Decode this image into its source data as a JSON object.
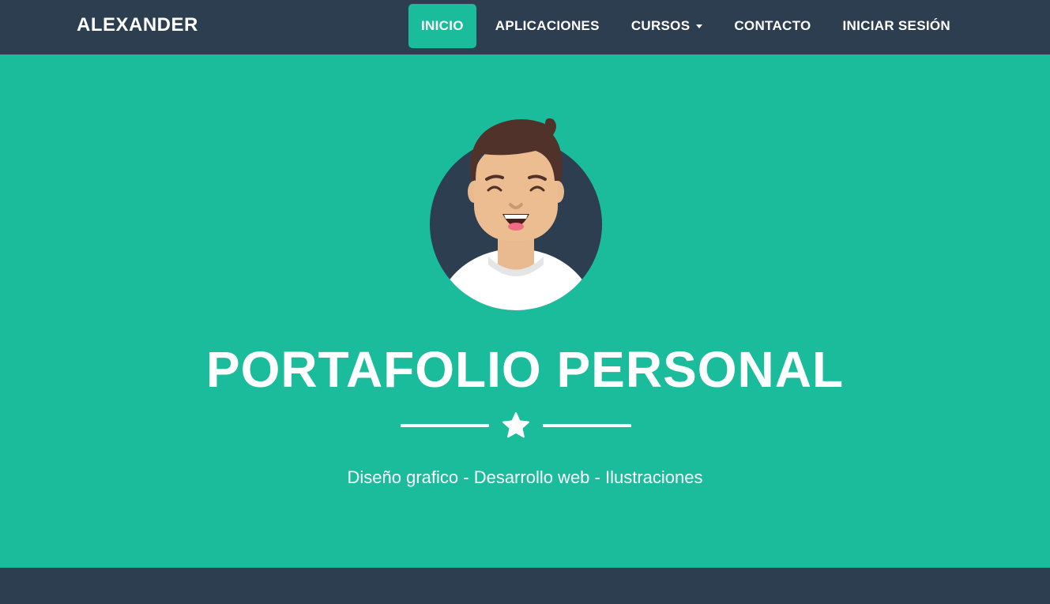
{
  "navbar": {
    "brand": "ALEXANDER",
    "links": [
      {
        "label": "INICIO",
        "active": true
      },
      {
        "label": "APLICACIONES"
      },
      {
        "label": "CURSOS",
        "dropdown": true
      },
      {
        "label": "CONTACTO"
      },
      {
        "label": "INICIAR SESIÓN"
      }
    ]
  },
  "masthead": {
    "avatar_icon": "avatar-man-smiling",
    "title": "PORTAFOLIO PERSONAL",
    "divider_icon": "star-icon",
    "subtitle": "Diseño grafico - Desarrollo web - Ilustraciones"
  },
  "colors": {
    "primary": "#1abc9c",
    "dark": "#2c3e50",
    "text": "#ffffff"
  }
}
